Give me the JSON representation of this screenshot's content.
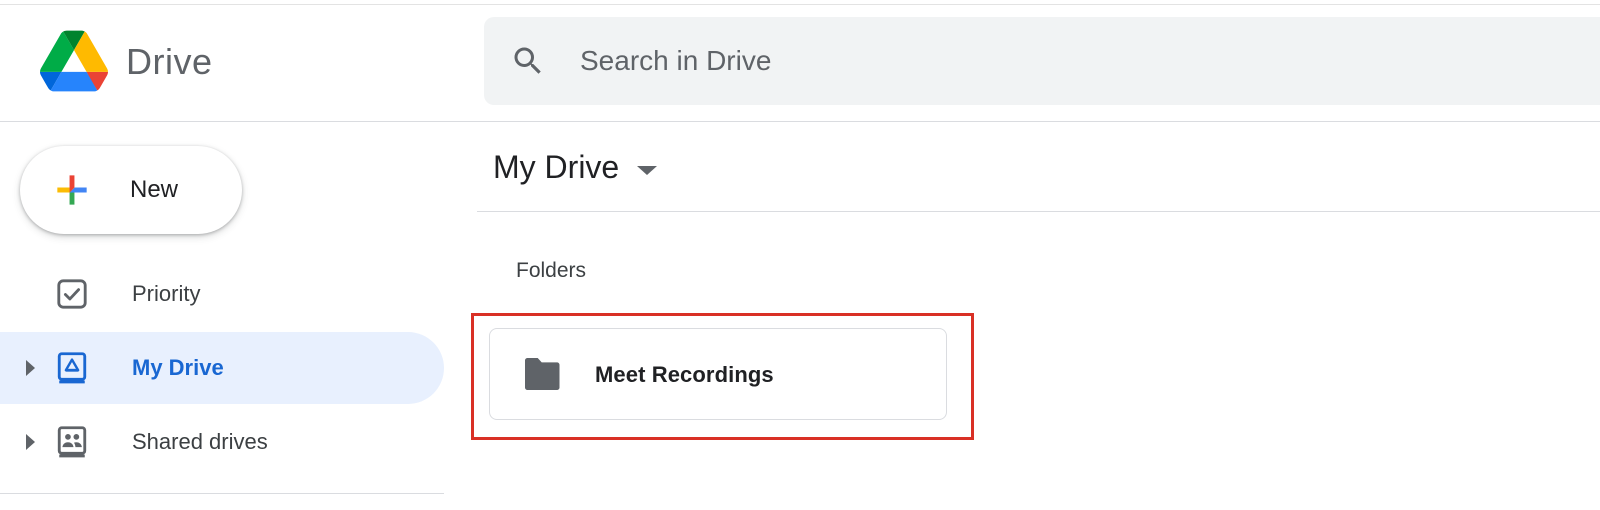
{
  "header": {
    "product_name": "Drive",
    "logo_icon": "google-drive-logo",
    "search": {
      "icon": "search-icon",
      "placeholder": "Search in Drive",
      "value": ""
    }
  },
  "sidebar": {
    "new_button": {
      "label": "New",
      "icon": "plus-icon"
    },
    "items": [
      {
        "label": "Priority",
        "icon": "checkbox-icon",
        "expandable": false,
        "active": false
      },
      {
        "label": "My Drive",
        "icon": "my-drive-icon",
        "expandable": true,
        "active": true
      },
      {
        "label": "Shared drives",
        "icon": "shared-drives-icon",
        "expandable": true,
        "active": false
      }
    ]
  },
  "main": {
    "title": "My Drive",
    "section_label": "Folders",
    "folders": [
      {
        "name": "Meet Recordings",
        "icon": "folder-icon"
      }
    ]
  },
  "colors": {
    "accent_blue": "#1967d2",
    "active_bg": "#e8f0fe",
    "search_bg": "#f1f3f4",
    "highlight_red": "#d93025",
    "icon_gray": "#5f6368"
  }
}
